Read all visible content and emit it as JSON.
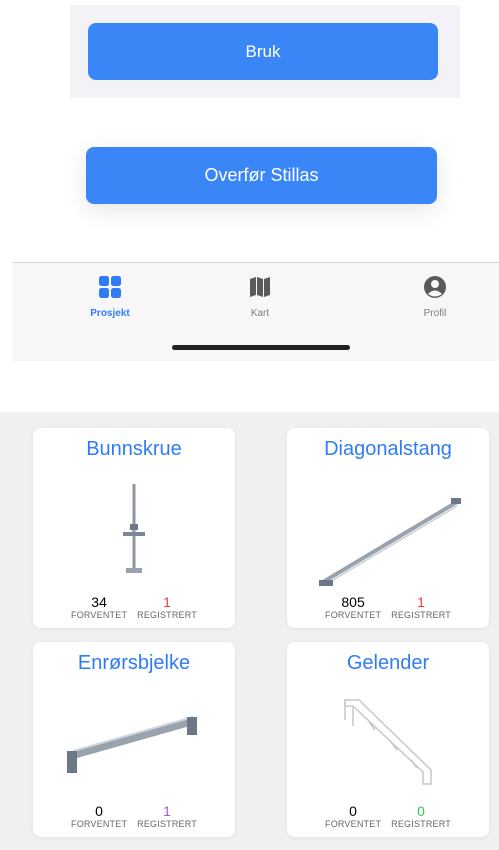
{
  "top": {
    "bruk_label": "Bruk",
    "overfor_label": "Overfør Stillas"
  },
  "tabbar": {
    "tabs": [
      {
        "label": "Prosjekt",
        "icon": "grid-icon",
        "active": true
      },
      {
        "label": "Kart",
        "icon": "map-icon",
        "active": false
      },
      {
        "label": "Profil",
        "icon": "person-icon",
        "active": false
      }
    ]
  },
  "cards": [
    {
      "title": "Bunnskrue",
      "expected": "34",
      "expected_label": "FORVENTET",
      "registered": "1",
      "registered_label": "REGISTRERT",
      "registered_color": "#ff3b30"
    },
    {
      "title": "Diagonalstang",
      "expected": "805",
      "expected_label": "FORVENTET",
      "registered": "1",
      "registered_label": "REGISTRERT",
      "registered_color": "#ff3b30"
    },
    {
      "title": "Enrørsbjelke",
      "expected": "0",
      "expected_label": "FORVENTET",
      "registered": "1",
      "registered_label": "REGISTRERT",
      "registered_color": "#af52de"
    },
    {
      "title": "Gelender",
      "expected": "0",
      "expected_label": "FORVENTET",
      "registered": "0",
      "registered_label": "REGISTRERT",
      "registered_color": "#34c759"
    }
  ],
  "colors": {
    "accent": "#3a86f7"
  }
}
